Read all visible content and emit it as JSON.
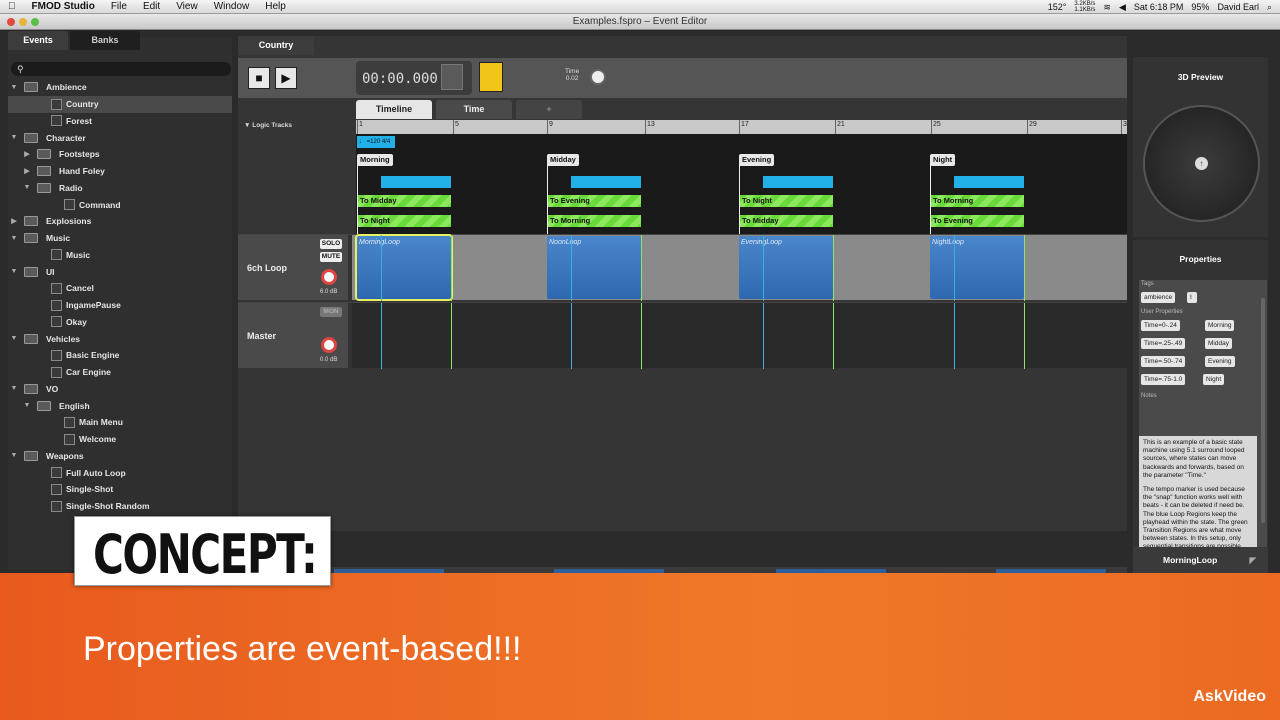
{
  "menubar": {
    "apple": "",
    "app_name": "FMOD Studio",
    "items": [
      "File",
      "Edit",
      "View",
      "Window",
      "Help"
    ],
    "status": {
      "temp": "152°",
      "net_up": "3.2KB/s",
      "net_down": "1.1KB/s",
      "battery": "95%",
      "clock": "Sat 6:18 PM",
      "user": "David Earl"
    }
  },
  "window": {
    "title": "Examples.fspro – Event Editor"
  },
  "left_tabs": {
    "events": "Events",
    "banks": "Banks"
  },
  "search": {
    "icon": "search-icon"
  },
  "tree": [
    {
      "level": 0,
      "type": "folder",
      "expanded": true,
      "label": "Ambience"
    },
    {
      "level": 1,
      "type": "event",
      "label": "Country",
      "selected": true
    },
    {
      "level": 1,
      "type": "event",
      "label": "Forest"
    },
    {
      "level": 0,
      "type": "folder",
      "expanded": true,
      "label": "Character"
    },
    {
      "level": 1,
      "type": "folder",
      "expanded": false,
      "label": "Footsteps"
    },
    {
      "level": 1,
      "type": "folder",
      "expanded": false,
      "label": "Hand Foley"
    },
    {
      "level": 1,
      "type": "folder",
      "expanded": true,
      "label": "Radio"
    },
    {
      "level": 2,
      "type": "event",
      "label": "Command"
    },
    {
      "level": 0,
      "type": "folder",
      "expanded": false,
      "label": "Explosions"
    },
    {
      "level": 0,
      "type": "folder",
      "expanded": true,
      "label": "Music"
    },
    {
      "level": 1,
      "type": "event",
      "label": "Music"
    },
    {
      "level": 0,
      "type": "folder",
      "expanded": true,
      "label": "UI"
    },
    {
      "level": 1,
      "type": "event",
      "label": "Cancel"
    },
    {
      "level": 1,
      "type": "event",
      "label": "IngamePause"
    },
    {
      "level": 1,
      "type": "event",
      "label": "Okay"
    },
    {
      "level": 0,
      "type": "folder",
      "expanded": true,
      "label": "Vehicles"
    },
    {
      "level": 1,
      "type": "event",
      "label": "Basic Engine"
    },
    {
      "level": 1,
      "type": "event",
      "label": "Car Engine"
    },
    {
      "level": 0,
      "type": "folder",
      "expanded": true,
      "label": "VO"
    },
    {
      "level": 1,
      "type": "folder",
      "expanded": true,
      "label": "English"
    },
    {
      "level": 2,
      "type": "event",
      "label": "Main Menu"
    },
    {
      "level": 2,
      "type": "event",
      "label": "Welcome"
    },
    {
      "level": 0,
      "type": "folder",
      "expanded": true,
      "label": "Weapons"
    },
    {
      "level": 1,
      "type": "event",
      "label": "Full Auto Loop"
    },
    {
      "level": 1,
      "type": "event",
      "label": "Single-Shot"
    },
    {
      "level": 1,
      "type": "event",
      "label": "Single-Shot Random"
    }
  ],
  "editor": {
    "event_tab": "Country",
    "timecode": "00:00.000",
    "time_param_label": "Time",
    "time_param_value": "0.02",
    "tabs": {
      "timeline": "Timeline",
      "time": "Time",
      "add": "+"
    },
    "logic_tracks": "Logic Tracks",
    "ruler": [
      "1",
      "5",
      "9",
      "13",
      "17",
      "21",
      "25",
      "29",
      "3"
    ],
    "tempo": "♩ =120 4/4",
    "states": [
      {
        "marker": "Morning",
        "t1": "To Midday",
        "t2": "To Night",
        "region": "MorningLoop"
      },
      {
        "marker": "Midday",
        "t1": "To Evening",
        "t2": "To Morning",
        "region": "NoonLoop"
      },
      {
        "marker": "Evening",
        "t1": "To Night",
        "t2": "To Midday",
        "region": "EveningLoop"
      },
      {
        "marker": "Night",
        "t1": "To Morning",
        "t2": "To Evening",
        "region": "NightLoop"
      }
    ],
    "tracks": [
      {
        "name": "6ch Loop",
        "solo": "SOLO",
        "mute": "MUTE",
        "volume": "6.0 dB"
      },
      {
        "name": "Master",
        "mon": "MON",
        "volume": "0.0 dB"
      }
    ]
  },
  "right": {
    "preview_title": "3D Preview",
    "properties_title": "Properties",
    "tags_label": "Tags",
    "tags": [
      "ambience"
    ],
    "user_props_label": "User Properties",
    "user_props": [
      {
        "key": "Time=0-.24",
        "value": "Morning"
      },
      {
        "key": "Time=.25-.49",
        "value": "Midday"
      },
      {
        "key": "Time=.50-.74",
        "value": "Evening"
      },
      {
        "key": "Time=.75-1.0",
        "value": "Night"
      }
    ],
    "notes_label": "Notes",
    "notes_p1": "This is an example of a basic state machine using 5.1 surround looped sources, where states can move backwards and forwards, based on the parameter \"Time.\"",
    "notes_p2": "The tempo marker is used because the \"snap\" function works well with beats - it can be deleted if need be. The blue Loop Regions keep the playhead within the state. The green Transition Regions are what move between states. In this setup, only sequential transitions are possible, but in both directions. For",
    "selection_label": "MorningLoop"
  },
  "overlay": {
    "concept": "CONCEPT:",
    "subtitle": "Properties are event-based!!!",
    "brand": "AskVideo"
  },
  "colors": {
    "accent_blue": "#22b0e8",
    "transition_green": "#6ad93a",
    "region_blue": "#3a78c2",
    "banner_orange": "#f07828"
  }
}
